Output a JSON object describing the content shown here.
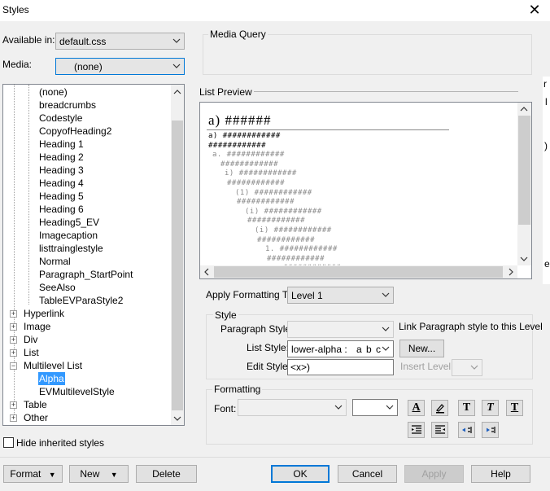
{
  "window": {
    "title": "Styles"
  },
  "available_in": {
    "label": "Available in:",
    "value": "default.css"
  },
  "media": {
    "label": "Media:",
    "value": "(none)"
  },
  "media_query": {
    "label": "Media Query"
  },
  "list_preview": {
    "label": "List Preview",
    "heading": "a)  ######",
    "lines": [
      "a) ############",
      "############",
      "a. ############",
      "############",
      "i) ############",
      "############",
      "(1) ############",
      "############",
      "(i) ############",
      "############",
      "(i) ############",
      "############",
      "1. ############",
      "############",
      "- ############"
    ]
  },
  "tree": {
    "top_items": [
      "(none)",
      "breadcrumbs",
      "Codestyle",
      "CopyofHeading2",
      "Heading 1",
      "Heading 2",
      "Heading 3",
      "Heading 4",
      "Heading 5",
      "Heading 6",
      "Heading5_EV",
      "Imagecaption",
      "listtrainglestyle",
      "Normal",
      "Paragraph_StartPoint",
      "SeeAlso",
      "TableEVParaStyle2"
    ],
    "groups": [
      "Hyperlink",
      "Image",
      "Div",
      "List",
      "Multilevel List"
    ],
    "multilevel_children": [
      "Alpha",
      "EVMultilevelStyle"
    ],
    "bottom_groups": [
      "Table",
      "Other"
    ],
    "selected": "Alpha"
  },
  "hide_inherited": {
    "label": "Hide inherited styles",
    "checked": false
  },
  "apply_formatting": {
    "label": "Apply Formatting To:",
    "value": "Level 1"
  },
  "style_group": {
    "label": "Style",
    "paragraph_style_label": "Paragraph Style:",
    "paragraph_style_value": "",
    "link_label": "Link Paragraph style to this Level",
    "list_style_label": "List Style:",
    "list_style_value": "lower-alpha :",
    "list_style_sample": "a b c",
    "new_label": "New...",
    "edit_style_label": "Edit Style:",
    "edit_style_value": "<x>)",
    "insert_level_label": "Insert Level:"
  },
  "formatting_group": {
    "label": "Formatting",
    "font_label": "Font:",
    "font_value": "",
    "size_value": ""
  },
  "buttons": {
    "format": "Format",
    "new": "New",
    "delete": "Delete",
    "ok": "OK",
    "cancel": "Cancel",
    "apply": "Apply",
    "help": "Help"
  },
  "background_text": {
    "r": "r",
    "l": "l",
    "paren": ")",
    "e": "e"
  }
}
